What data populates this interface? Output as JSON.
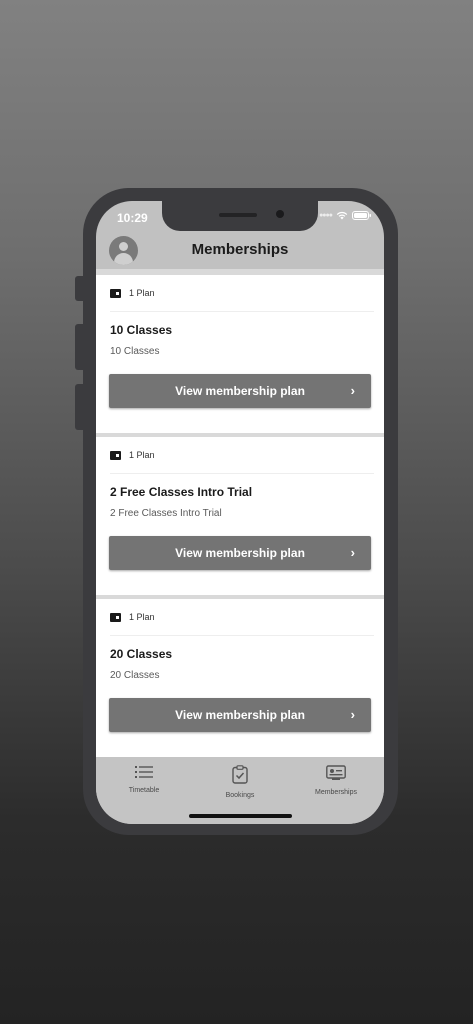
{
  "status_bar": {
    "time": "10:29"
  },
  "header": {
    "title": "Memberships"
  },
  "memberships": [
    {
      "plan_count": "1 Plan",
      "title": "10 Classes",
      "subtitle": "10 Classes",
      "button_label": "View membership plan"
    },
    {
      "plan_count": "1 Plan",
      "title": "2 Free Classes Intro Trial",
      "subtitle": "2 Free Classes Intro Trial",
      "button_label": "View membership plan"
    },
    {
      "plan_count": "1 Plan",
      "title": "20 Classes",
      "subtitle": "20 Classes",
      "button_label": "View membership plan"
    }
  ],
  "tabbar": {
    "items": [
      {
        "label": "Timetable",
        "icon": "list-icon"
      },
      {
        "label": "Bookings",
        "icon": "clipboard-check-icon"
      },
      {
        "label": "Memberships",
        "icon": "membership-card-icon"
      }
    ]
  },
  "colors": {
    "button": "#747474",
    "header_bg": "#c1c1c1",
    "card_bg": "#ffffff"
  }
}
